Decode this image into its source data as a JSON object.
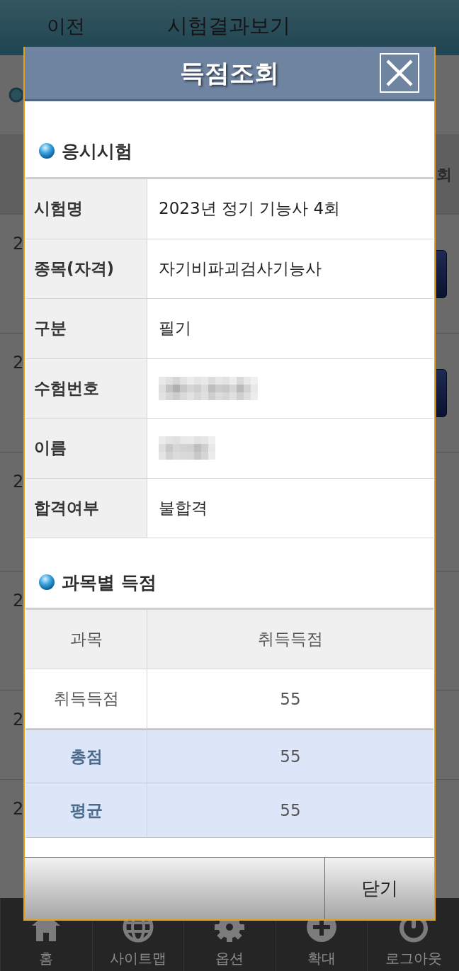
{
  "top_bar": {
    "back_button": "이전",
    "title": "시험결과보기"
  },
  "result_list": {
    "column_header": "회",
    "rows": [
      {
        "column_1": "2",
        "has_button": true
      },
      {
        "column_1": "2",
        "has_button": true
      },
      {
        "column_1": "2",
        "has_button": false
      },
      {
        "column_1": "2",
        "has_button": false
      },
      {
        "column_1": "2",
        "has_button": false
      },
      {
        "column_1": "2",
        "has_button": false
      }
    ]
  },
  "dialog": {
    "title": "득점조회",
    "sections": [
      {
        "kind": "info",
        "heading": "응시시험",
        "rows": [
          {
            "label": "시험명",
            "value": "2023년 정기 기능사 4회",
            "redacted": false
          },
          {
            "label": "종목(자격)",
            "value": "자기비파괴검사기능사",
            "redacted": false
          },
          {
            "label": "구분",
            "value": "필기",
            "redacted": false
          },
          {
            "label": "수험번호",
            "redacted": true
          },
          {
            "label": "이름",
            "redacted": true
          },
          {
            "label": "합격여부",
            "value": "불합격",
            "redacted": false
          }
        ]
      },
      {
        "kind": "scores",
        "heading": "과목별 득점",
        "columns": [
          "과목",
          "취득득점"
        ],
        "rows": [
          {
            "kind": "body",
            "cells": [
              "취득득점",
              "55"
            ]
          },
          {
            "kind": "summary",
            "cells": [
              "총점",
              "55"
            ]
          },
          {
            "kind": "summary",
            "cells": [
              "평균",
              "55"
            ]
          }
        ]
      }
    ],
    "buttons": [
      "닫기"
    ]
  },
  "bottom_nav": {
    "items": [
      {
        "label": "홈"
      },
      {
        "label": "사이트맵"
      },
      {
        "label": "옵션"
      },
      {
        "label": "확대"
      },
      {
        "label": "로그아웃"
      }
    ]
  }
}
